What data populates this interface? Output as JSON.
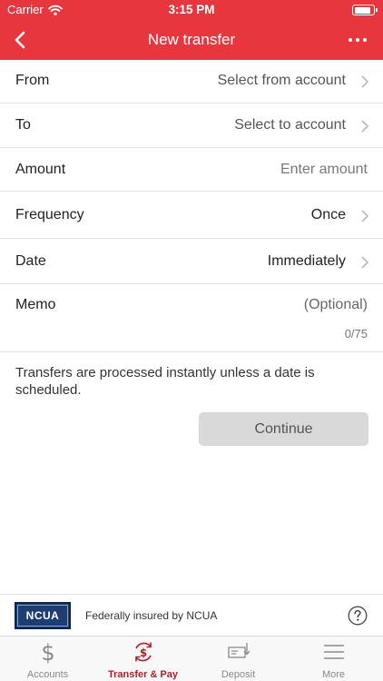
{
  "status_bar": {
    "carrier": "Carrier",
    "time": "3:15 PM",
    "battery_percent": 90
  },
  "nav": {
    "title": "New transfer"
  },
  "form": {
    "from": {
      "label": "From",
      "value": "Select from account"
    },
    "to": {
      "label": "To",
      "value": "Select to account"
    },
    "amount": {
      "label": "Amount",
      "placeholder": "Enter amount"
    },
    "frequency": {
      "label": "Frequency",
      "value": "Once"
    },
    "date": {
      "label": "Date",
      "value": "Immediately"
    },
    "memo": {
      "label": "Memo",
      "placeholder": "(Optional)",
      "counter": "0/75"
    }
  },
  "notice": "Transfers are processed instantly unless a date is scheduled.",
  "continue_label": "Continue",
  "insurance": {
    "logo_text": "NCUA",
    "text": "Federally insured by NCUA"
  },
  "tabs": [
    {
      "label": "Accounts",
      "icon": "dollar-icon"
    },
    {
      "label": "Transfer & Pay",
      "icon": "transfer-pay-icon",
      "active": true
    },
    {
      "label": "Deposit",
      "icon": "check-deposit-icon"
    },
    {
      "label": "More",
      "icon": "menu-icon"
    }
  ],
  "colors": {
    "brand_red": "#e8363f",
    "active_tab": "#b01e2c",
    "button_disabled": "#d9d9d9"
  }
}
